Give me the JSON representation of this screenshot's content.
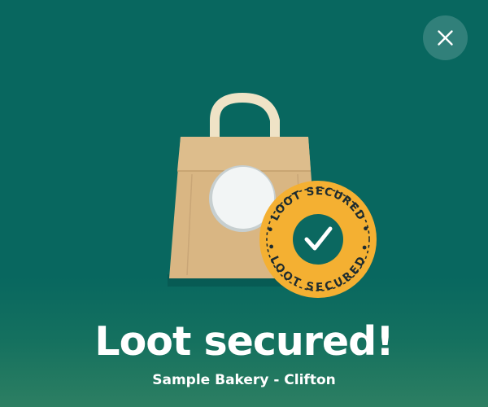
{
  "screen": {
    "background_color": "#08675f",
    "bottom_gradient_color": "#2d7f62"
  },
  "close_button": {
    "icon": "close-icon"
  },
  "illustration": {
    "bag_icon": "shopping-bag-icon",
    "bag_color": "#d9b683",
    "handle_color": "#efe3c6",
    "seal_color": "#f4b032",
    "seal_center_color": "#0b6860",
    "seal_text_top": "• LOOT SECURED •",
    "seal_text_bottom": "• LOOT SECURED •",
    "check_icon": "checkmark-icon"
  },
  "headline": "Loot secured!",
  "store_name": "Sample Bakery - Clifton"
}
